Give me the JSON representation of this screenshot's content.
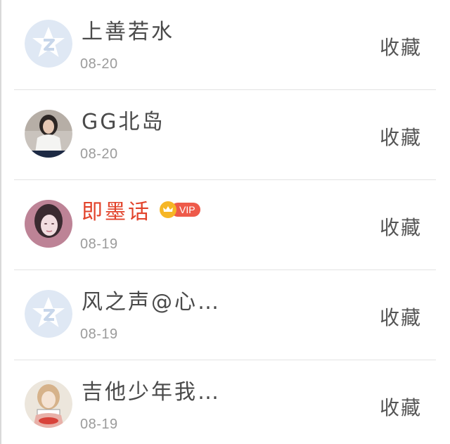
{
  "items": [
    {
      "name": "上善若水",
      "date": "08-20",
      "avatar": "default-qq-avatar-icon",
      "action": "收藏",
      "vip": false
    },
    {
      "name": "GG北岛",
      "date": "08-20",
      "avatar": "user-photo-avatar",
      "action": "收藏",
      "vip": false
    },
    {
      "name": "即墨话",
      "date": "08-19",
      "avatar": "user-photo-avatar",
      "action": "收藏",
      "vip": true,
      "vip_label": "VIP"
    },
    {
      "name": "风之声@心…",
      "date": "08-19",
      "avatar": "default-qq-avatar-icon",
      "action": "收藏",
      "vip": false
    },
    {
      "name": "吉他少年我…",
      "date": "08-19",
      "avatar": "user-photo-avatar",
      "action": "收藏",
      "vip": false
    }
  ],
  "colors": {
    "name_text": "#4a4a4a",
    "vip_name_text": "#e2432b",
    "date_text": "#9b9b9b",
    "divider": "#e3e3e3",
    "vip_badge": "#ee5a4a",
    "vip_crown": "#f6b626",
    "default_avatar_bg": "#dfe8f4"
  }
}
